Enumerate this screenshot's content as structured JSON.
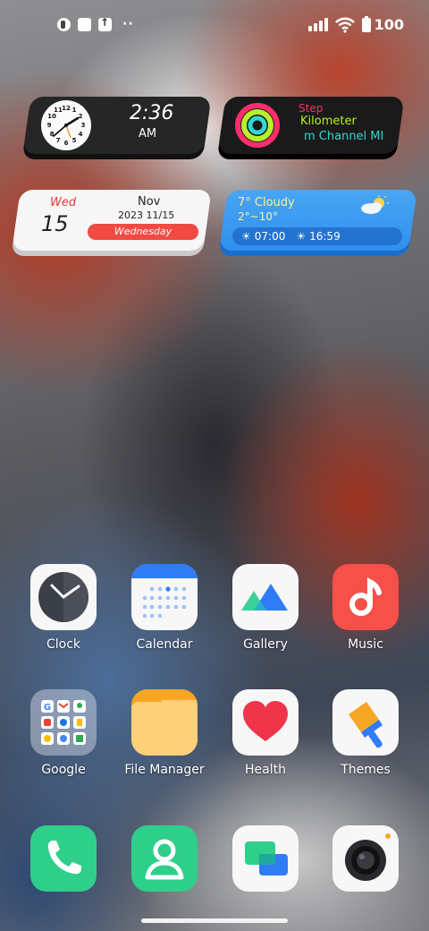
{
  "status_bar": {
    "battery_level": "100",
    "dots": "··"
  },
  "widgets": {
    "clock": {
      "time": "2:36",
      "ampm": "AM"
    },
    "activity": {
      "line1": "Step",
      "line2": "Kilometer",
      "line3": "m Channel MI"
    },
    "calendar": {
      "weekday_short": "Wed",
      "day": "15",
      "month": "Nov",
      "date": "2023 11/15",
      "weekday_full": "Wednesday"
    },
    "weather": {
      "line1": "7° Cloudy",
      "line2": "2°~10°",
      "sunrise": "07:00",
      "sunset": "16:59"
    }
  },
  "apps_row1": [
    {
      "label": "Clock",
      "icon": "clock-icon"
    },
    {
      "label": "Calendar",
      "icon": "calendar-icon"
    },
    {
      "label": "Gallery",
      "icon": "gallery-icon"
    },
    {
      "label": "Music",
      "icon": "music-icon"
    }
  ],
  "apps_row2": [
    {
      "label": "Google",
      "icon": "google-folder-icon"
    },
    {
      "label": "File Manager",
      "icon": "folder-icon"
    },
    {
      "label": "Health",
      "icon": "heart-icon"
    },
    {
      "label": "Themes",
      "icon": "paint-brush-icon"
    }
  ],
  "dock": [
    {
      "icon": "phone-icon"
    },
    {
      "icon": "contacts-icon"
    },
    {
      "icon": "messages-icon"
    },
    {
      "icon": "camera-icon"
    }
  ]
}
